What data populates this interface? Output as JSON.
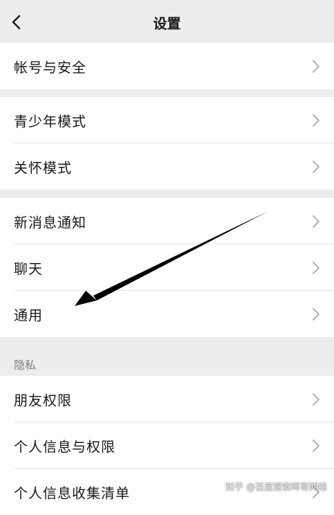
{
  "nav": {
    "title": "设置",
    "back_icon": "chevron-left-icon"
  },
  "groups": [
    {
      "items": [
        {
          "label": "帐号与安全"
        }
      ]
    },
    {
      "items": [
        {
          "label": "青少年模式"
        },
        {
          "label": "关怀模式"
        }
      ]
    },
    {
      "items": [
        {
          "label": "新消息通知"
        },
        {
          "label": "聊天"
        },
        {
          "label": "通用"
        }
      ]
    },
    {
      "header": "隐私",
      "items": [
        {
          "label": "朋友权限"
        },
        {
          "label": "个人信息与权限"
        },
        {
          "label": "个人信息收集清单"
        }
      ]
    }
  ],
  "annotation": {
    "icon": "arrow-icon",
    "color": "#000000"
  },
  "watermark": "知乎 @百度搜索晖哥网络",
  "colors": {
    "background": "#ededed",
    "card": "#ffffff",
    "text": "#191919",
    "secondary_text": "#7f7f7f",
    "chevron": "#b2b2b2"
  }
}
